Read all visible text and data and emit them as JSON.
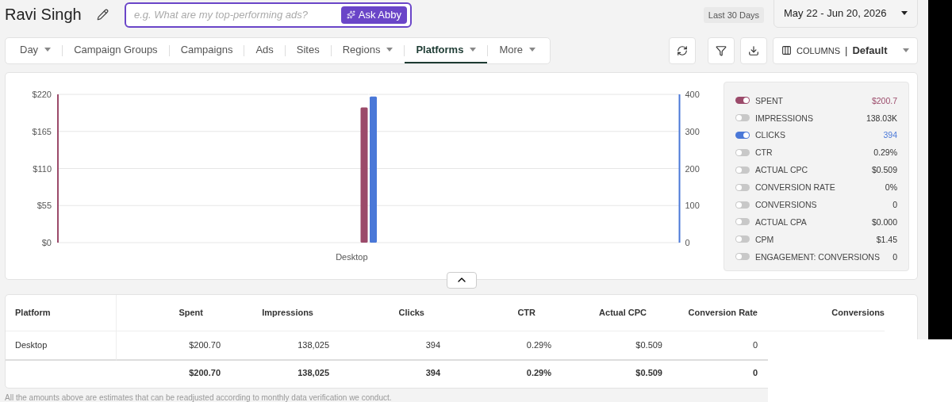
{
  "header": {
    "title": "Ravi Singh",
    "ask": {
      "placeholder": "e.g. What are my top-performing ads?",
      "button": "Ask Abby"
    },
    "range_chip": "Last 30 Days",
    "date_range": "May 22 - Jun 20, 2026"
  },
  "tabs": [
    {
      "label": "Day",
      "dropdown": true,
      "selected": false
    },
    {
      "label": "Campaign Groups",
      "dropdown": false,
      "selected": false
    },
    {
      "label": "Campaigns",
      "dropdown": false,
      "selected": false
    },
    {
      "label": "Ads",
      "dropdown": false,
      "selected": false
    },
    {
      "label": "Sites",
      "dropdown": false,
      "selected": false
    },
    {
      "label": "Regions",
      "dropdown": true,
      "selected": false
    },
    {
      "label": "Platforms",
      "dropdown": true,
      "selected": true
    },
    {
      "label": "More",
      "dropdown": true,
      "selected": false
    }
  ],
  "columns_picker": {
    "label": "COLUMNS",
    "separator": "|",
    "value": "Default"
  },
  "chart": {
    "spent_chart": {
      "chart_data": {
        "type": "bar",
        "categories": [
          "Desktop"
        ],
        "grid": true,
        "series": [
          {
            "color": "#9b4a6a",
            "values": [
              200.7
            ]
          }
        ],
        "ylim": [
          0,
          220
        ],
        "yticks": [
          {
            "value": 0,
            "label": "$0"
          },
          {
            "value": 55,
            "label": "$55"
          },
          {
            "value": 110,
            "label": "$110"
          },
          {
            "value": 165,
            "label": "$165"
          },
          {
            "value": 220,
            "label": "$220"
          }
        ]
      }
    },
    "clicks_chart": {
      "chart_data": {
        "type": "bar",
        "categories": [
          null
        ],
        "grid": true,
        "series": [
          {
            "color": "#4a78d8",
            "values": [
              394
            ]
          }
        ],
        "ylim": [
          0,
          400
        ],
        "yticks": [
          0,
          100,
          200,
          300,
          400
        ]
      }
    }
  },
  "legend": [
    {
      "label": "SPENT",
      "value": "$200.7",
      "on": true,
      "color": "#9b4a6a"
    },
    {
      "label": "IMPRESSIONS",
      "value": "138.03K",
      "on": false
    },
    {
      "label": "CLICKS",
      "value": "394",
      "on": true,
      "color": "#4a78d8"
    },
    {
      "label": "CTR",
      "value": "0.29%",
      "on": false
    },
    {
      "label": "ACTUAL CPC",
      "value": "$0.509",
      "on": false
    },
    {
      "label": "CONVERSION RATE",
      "value": "0%",
      "on": false
    },
    {
      "label": "CONVERSIONS",
      "value": "0",
      "on": false
    },
    {
      "label": "ACTUAL CPA",
      "value": "$0.000",
      "on": false
    },
    {
      "label": "CPM",
      "value": "$1.45",
      "on": false
    },
    {
      "label": "ENGAGEMENT: CONVERSIONS",
      "value": "0",
      "on": false
    }
  ],
  "table": {
    "columns": [
      "Platform",
      "Spent",
      "Impressions",
      "Clicks",
      "CTR",
      "Actual CPC",
      "Conversion Rate",
      "Conversions"
    ],
    "rows": [
      [
        "Desktop",
        "$200.70",
        "138,025",
        "394",
        "0.29%",
        "$0.509",
        "0"
      ]
    ],
    "total": [
      "$200.70",
      "138,025",
      "394",
      "0.29%",
      "$0.509",
      "0"
    ]
  },
  "footnote": "All the amounts above are estimates that can be readjusted according to monthly data verification we conduct."
}
